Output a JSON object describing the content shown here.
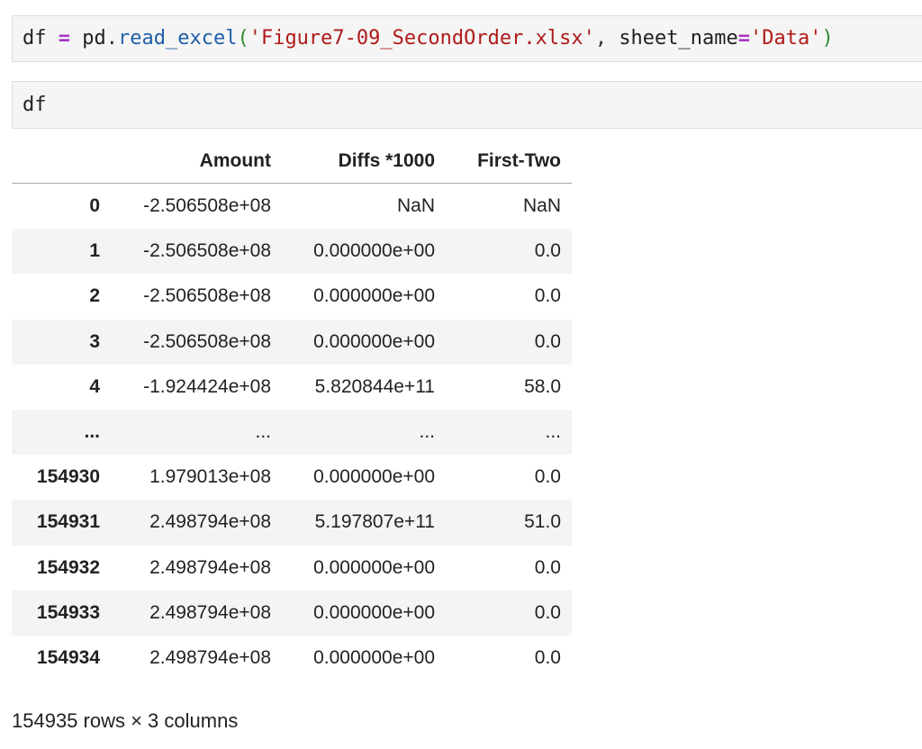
{
  "cells": [
    {
      "tokens": [
        {
          "text": "df",
          "cls": "tok-var"
        },
        {
          "text": " ",
          "cls": "tok-punct"
        },
        {
          "text": "=",
          "cls": "tok-op"
        },
        {
          "text": " ",
          "cls": "tok-punct"
        },
        {
          "text": "pd",
          "cls": "tok-var"
        },
        {
          "text": ".",
          "cls": "tok-punct"
        },
        {
          "text": "read_excel",
          "cls": "tok-func"
        },
        {
          "text": "(",
          "cls": "tok-paren"
        },
        {
          "text": "'Figure7-09_SecondOrder.xlsx'",
          "cls": "tok-str"
        },
        {
          "text": ", ",
          "cls": "tok-punct"
        },
        {
          "text": "sheet_name",
          "cls": "tok-kw"
        },
        {
          "text": "=",
          "cls": "tok-op"
        },
        {
          "text": "'Data'",
          "cls": "tok-str"
        },
        {
          "text": ")",
          "cls": "tok-paren"
        }
      ]
    },
    {
      "tokens": [
        {
          "text": "df",
          "cls": "tok-var"
        }
      ]
    }
  ],
  "dataframe": {
    "index_header": "",
    "columns": [
      "Amount",
      "Diffs *1000",
      "First-Two"
    ],
    "rows": [
      {
        "index": "0",
        "values": [
          "-2.506508e+08",
          "NaN",
          "NaN"
        ]
      },
      {
        "index": "1",
        "values": [
          "-2.506508e+08",
          "0.000000e+00",
          "0.0"
        ]
      },
      {
        "index": "2",
        "values": [
          "-2.506508e+08",
          "0.000000e+00",
          "0.0"
        ]
      },
      {
        "index": "3",
        "values": [
          "-2.506508e+08",
          "0.000000e+00",
          "0.0"
        ]
      },
      {
        "index": "4",
        "values": [
          "-1.924424e+08",
          "5.820844e+11",
          "58.0"
        ]
      },
      {
        "index": "...",
        "values": [
          "...",
          "...",
          "..."
        ]
      },
      {
        "index": "154930",
        "values": [
          "1.979013e+08",
          "0.000000e+00",
          "0.0"
        ]
      },
      {
        "index": "154931",
        "values": [
          "2.498794e+08",
          "5.197807e+11",
          "51.0"
        ]
      },
      {
        "index": "154932",
        "values": [
          "2.498794e+08",
          "0.000000e+00",
          "0.0"
        ]
      },
      {
        "index": "154933",
        "values": [
          "2.498794e+08",
          "0.000000e+00",
          "0.0"
        ]
      },
      {
        "index": "154934",
        "values": [
          "2.498794e+08",
          "0.000000e+00",
          "0.0"
        ]
      }
    ],
    "shape_text": "154935 rows × 3 columns"
  }
}
